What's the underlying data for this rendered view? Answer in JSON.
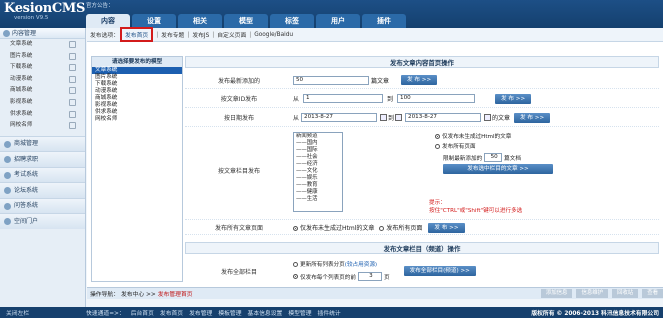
{
  "app": {
    "name": "KesionCMS",
    "version": "version V9.5",
    "notice": "官方公告："
  },
  "tabs": [
    "内容",
    "设置",
    "相关",
    "模型",
    "标签",
    "用户",
    "插件"
  ],
  "sidebar": {
    "header": "内容管理",
    "items": [
      "文章系统",
      "图片系统",
      "下载系统",
      "动漫系统",
      "商城系统",
      "影视系统",
      "供求系统",
      "网校名师"
    ],
    "sections": [
      "商城管理",
      "招聘求职",
      "考试系统",
      "论坛系统",
      "问答系统",
      "空间门户"
    ]
  },
  "crumb": {
    "label": "发布选项：",
    "items": [
      "发布首页",
      "发布专题",
      "发布JS",
      "自定义页面",
      "Google/Baidu"
    ]
  },
  "models": {
    "title": "请选择要发布的模型",
    "list": [
      "文章系统",
      "图片系统",
      "下载系统",
      "动漫系统",
      "商城系统",
      "影视系统",
      "供求系统",
      "网校名师"
    ]
  },
  "form": {
    "title": "发布文章内容首页操作",
    "latest": {
      "label": "发布最新添加的",
      "value": "50",
      "unit": "篇文章",
      "btn": "发 布 >>"
    },
    "byid": {
      "label": "按文章ID发布",
      "from": "从",
      "from_val": "1",
      "to": "到",
      "to_val": "100",
      "btn": "发 布 >>"
    },
    "bydate": {
      "label": "按日期发布",
      "from": "从",
      "from_val": "2013-8-27",
      "to": "到",
      "to_val": "2013-8-27",
      "unit": "的文章",
      "btn": "发 布 >>"
    },
    "bycat": {
      "label": "按文章栏目发布",
      "cats": [
        "新闻频道",
        "——国内",
        "——国际",
        "——社会",
        "——经济",
        "——文化",
        "——娱乐",
        "——教育",
        "——健康",
        "——生活"
      ],
      "opt1": "仅发布未生成过Html的文章",
      "opt2": "发布所有页面",
      "limit_pre": "限制最新添加的",
      "limit_val": "50",
      "limit_unit": "篇文档",
      "btn": "发布选中栏目的文章 >>",
      "tip1": "提示：",
      "tip2": "按住\"CTRL\"或\"Shift\"键可以进行多选"
    },
    "all": {
      "label": "发布所有文章页面",
      "opt1": "仅发布未生成过Html的文章",
      "opt2": "发布所有页面",
      "btn": "发 布 >>"
    },
    "title2": "发布文章栏目（频道）操作",
    "allcat": {
      "label": "发布全部栏目",
      "opt1": "更新所有列表分页",
      "link": "(较占用资源)",
      "opt2": "仅发布每个列表页的前",
      "val": "3",
      "unit": "页",
      "btn": "发布全部栏目(频道) >>"
    }
  },
  "opbar": {
    "label": "操作导航：",
    "path": "发布中心 >>",
    "current": "发布管理首页",
    "buttons": [
      "添加信息",
      "信息维护",
      "回收站",
      "查看"
    ]
  },
  "footer": {
    "left": "关闭左栏",
    "quick_label": "快速通道=>：",
    "links": [
      "后台首页",
      "发布首页",
      "发布管理",
      "模板管理",
      "基本信息设置",
      "模型管理",
      "插件统计"
    ],
    "copy": "版权所有 © 2006-2013 科汛信息技术有限公司"
  }
}
